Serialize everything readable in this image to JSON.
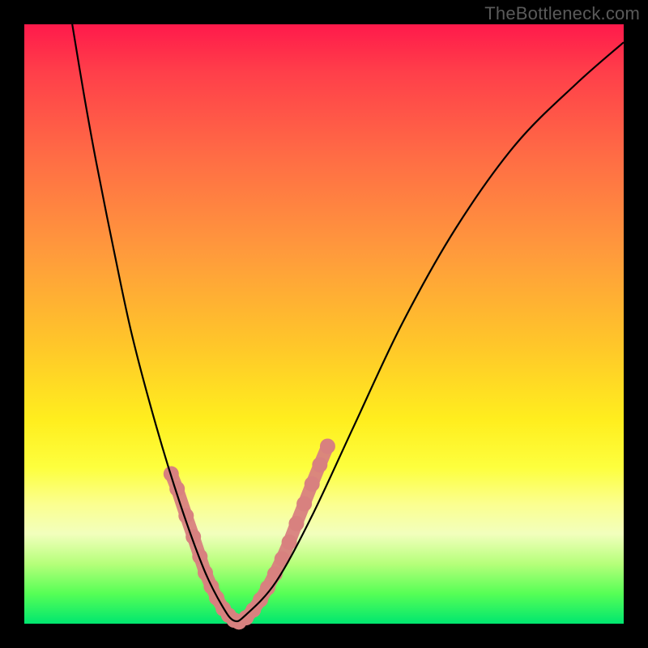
{
  "watermark": "TheBottleneck.com",
  "chart_data": {
    "type": "line",
    "title": "",
    "xlabel": "",
    "ylabel": "",
    "ylim": [
      0,
      100
    ],
    "xlim": [
      0,
      100
    ],
    "series": [
      {
        "name": "curve-black",
        "color": "#000000",
        "x": [
          8,
          10,
          12,
          15,
          18,
          22,
          26,
          30,
          33,
          35,
          37,
          42,
          48,
          55,
          63,
          72,
          82,
          92,
          100
        ],
        "y": [
          100,
          88,
          77,
          62,
          48,
          33,
          20,
          9,
          3,
          0.5,
          1.5,
          7,
          18,
          33,
          50,
          66,
          80,
          90,
          97
        ]
      },
      {
        "name": "marker-band",
        "color": "#d8817f",
        "segments": [
          {
            "x": [
              24.5,
              25.5,
              27,
              28.2,
              29.3,
              30.2,
              31.2,
              32.1,
              33.2,
              34.1,
              35.0,
              35.8
            ],
            "y": [
              25,
              22.5,
              18,
              14.5,
              11.2,
              8.5,
              6.2,
              4.3,
              2.5,
              1.4,
              0.6,
              0.3
            ]
          },
          {
            "x": [
              35.8,
              37.0,
              38.2,
              39.4,
              40.6,
              41.8,
              43.0,
              44.2,
              45.4,
              46.7,
              48.0,
              49.3,
              50.6
            ],
            "y": [
              0.3,
              1.0,
              2.3,
              4.0,
              6.0,
              8.3,
              10.8,
              13.6,
              16.7,
              20.0,
              23.3,
              26.5,
              29.6
            ]
          }
        ]
      }
    ]
  },
  "colors": {
    "curve": "#000000",
    "markers": "#d8817f",
    "background_top": "#ff1a4b",
    "background_bottom": "#00e66f"
  }
}
